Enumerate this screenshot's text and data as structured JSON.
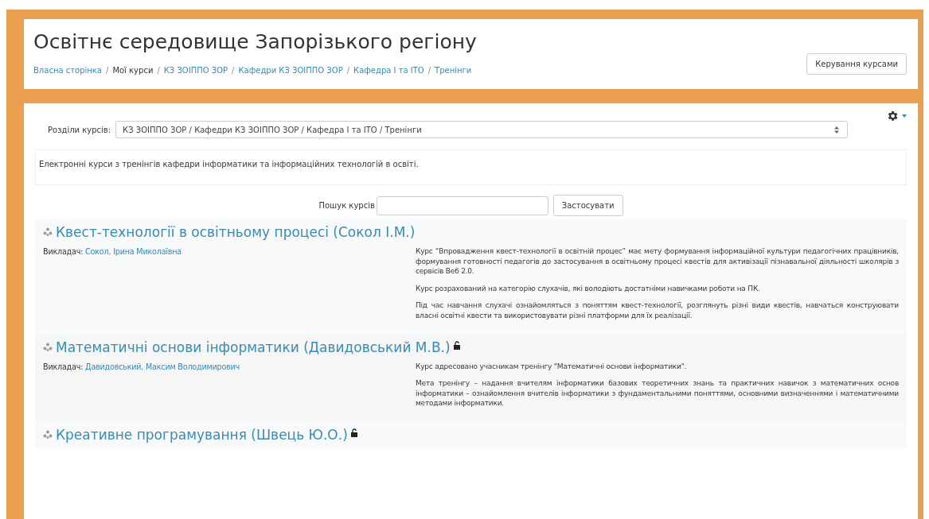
{
  "header": {
    "title": "Освітнє середовище Запорізького регіону",
    "breadcrumb_separator": "/",
    "breadcrumb": [
      {
        "label": "Власна сторінка",
        "kind": "link"
      },
      {
        "label": "Мої курси",
        "kind": "text"
      },
      {
        "label": "КЗ ЗОІППО ЗОР",
        "kind": "link"
      },
      {
        "label": "Кафедри КЗ ЗОІППО ЗОР",
        "kind": "link"
      },
      {
        "label": "Кафедра І та ІТО",
        "kind": "link"
      },
      {
        "label": "Тренінги",
        "kind": "link"
      }
    ],
    "button": "Керування курсами"
  },
  "category": {
    "label": "Розділи курсів:",
    "value": "КЗ ЗОІППО ЗОР / Кафедри КЗ ЗОІППО ЗОР / Кафедра І та ІТО / Тренінги"
  },
  "description": "Електронні курси з тренінгів кафедри інформатики та інформаційних технологій в освіті.",
  "search": {
    "label": "Пошук курсів",
    "button": "Застосувати"
  },
  "courses": [
    {
      "title": "Квест-технології в освітньому процесі (Сокол І.М.)",
      "guest_access": false,
      "teacher_label": "Викладач:",
      "teacher": "Сокол, Ірина Миколаївна",
      "summary": [
        "Курс “Впровадження квест-технології в освітній процес” має мету формування інформаційної культури педагогічних працівників, формування готовності педагогів до застосування в освітньому процесі квестів для активізації пізнавальної діяльності школярів з сервісів Веб 2.0.",
        "Курс розрахований на категорію слухачів, які володіють достатніми навичками роботи на ПК.",
        "Під час навчання слухачі ознайомляться з поняттям квест-технології, розглянуть різні види квестів, навчаться конструювати власні освітні квести та використовувати різні платформи для їх реалізації."
      ]
    },
    {
      "title": "Математичні основи інформатики (Давидовський М.В.)",
      "guest_access": true,
      "teacher_label": "Викладач:",
      "teacher": "Давидовський, Максим Володимирович",
      "summary": [
        "Курс адресовано учасникам тренінгу \"Математичні основи інформатики\".",
        "Мета тренінгу – надання вчителям інформатики базових теоретичних знань та практичних навичок з математичних основ інформатики – ознайомлення вчителів інформатики з фундаментальними поняттями, основними визначеннями і математичними методами інформатики."
      ]
    },
    {
      "title": "Креативне програмування (Швець Ю.О.)",
      "guest_access": true
    }
  ]
}
